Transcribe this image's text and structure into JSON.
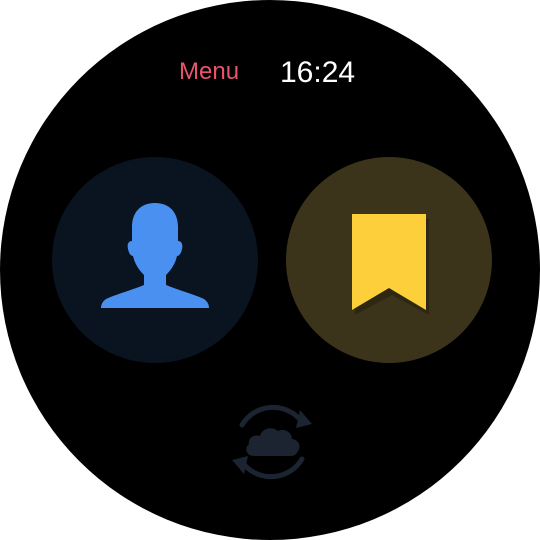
{
  "header": {
    "menu_label": "Menu",
    "time": "16:24"
  },
  "actions": {
    "contacts_icon": "person-icon",
    "bookmark_icon": "bookmark-icon",
    "sync_icon": "cloud-sync-icon"
  },
  "colors": {
    "menu_label": "#e8546d",
    "clock": "#ffffff",
    "contacts_bg": "#0a1320",
    "contacts_icon": "#4a90f0",
    "bookmark_bg": "#3b331a",
    "bookmark_icon": "#fdd03b",
    "sync_icon": "#1c2431"
  }
}
